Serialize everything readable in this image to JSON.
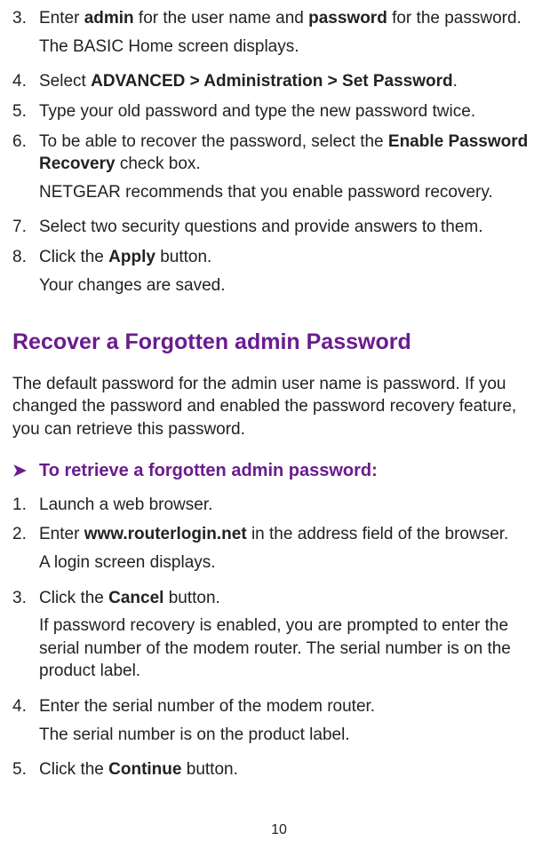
{
  "steps_a": [
    {
      "num": "3.",
      "parts": [
        "Enter ",
        "admin",
        " for the user name and ",
        "password",
        " for the password."
      ],
      "sub": [
        "The BASIC Home screen displays."
      ]
    },
    {
      "num": "4.",
      "parts": [
        "Select ",
        "ADVANCED > Administration > Set Password",
        "."
      ]
    },
    {
      "num": "5.",
      "parts": [
        "Type your old password and type the new password twice."
      ]
    },
    {
      "num": "6.",
      "parts": [
        "To be able to recover the password, select the ",
        "Enable Password Recovery",
        " check box."
      ],
      "sub": [
        "NETGEAR recommends that you enable password recovery."
      ]
    },
    {
      "num": "7.",
      "parts": [
        "Select two security questions and provide answers to them."
      ]
    },
    {
      "num": "8.",
      "parts": [
        "Click the ",
        "Apply",
        " button."
      ],
      "sub": [
        "Your changes are saved."
      ]
    }
  ],
  "heading": "Recover a Forgotten admin Password",
  "intro": "The default password for the admin user name is password. If you changed the password and enabled the password recovery feature, you can retrieve this password.",
  "task_arrow": "➤",
  "task": "To retrieve a forgotten admin password:",
  "steps_b": [
    {
      "num": "1.",
      "parts": [
        "Launch a web browser."
      ]
    },
    {
      "num": "2.",
      "parts": [
        "Enter ",
        "www.routerlogin.net",
        " in the address field of the browser."
      ],
      "sub": [
        "A login screen displays."
      ]
    },
    {
      "num": "3.",
      "parts": [
        "Click the ",
        "Cancel",
        " button."
      ],
      "sub": [
        "If password recovery is enabled, you are prompted to enter the serial number of the modem router. The serial number is on the product label."
      ]
    },
    {
      "num": "4.",
      "parts": [
        "Enter the serial number of the modem router."
      ],
      "sub": [
        "The serial number is on the product label."
      ]
    },
    {
      "num": "5.",
      "parts": [
        "Click the ",
        "Continue",
        " button."
      ]
    }
  ],
  "page_number": "10"
}
